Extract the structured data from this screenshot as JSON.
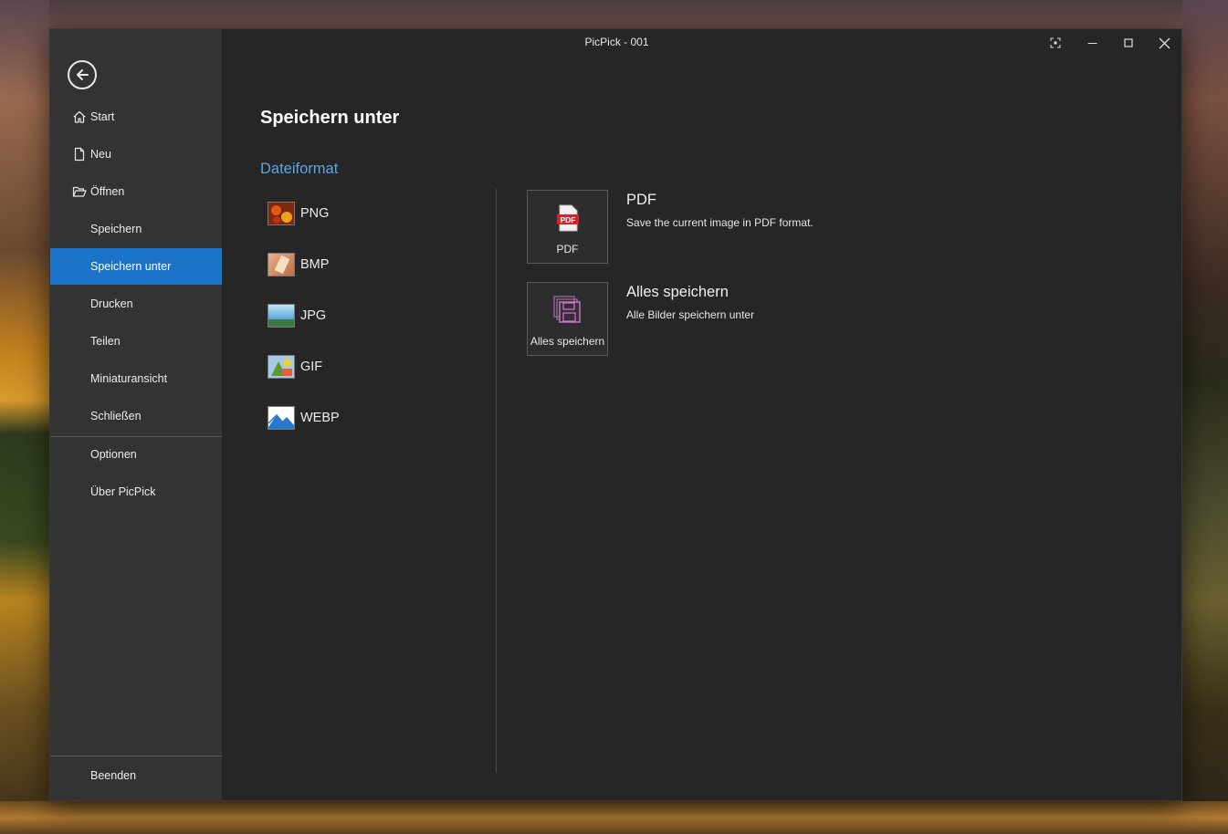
{
  "window": {
    "title": "PicPick - 001"
  },
  "sidebar": {
    "items": [
      {
        "label": "Start",
        "icon": "home-icon"
      },
      {
        "label": "Neu",
        "icon": "new-file-icon"
      },
      {
        "label": "Öffnen",
        "icon": "folder-open-icon"
      },
      {
        "label": "Speichern"
      },
      {
        "label": "Speichern unter",
        "active": true
      },
      {
        "label": "Drucken"
      },
      {
        "label": "Teilen"
      },
      {
        "label": "Miniaturansicht"
      },
      {
        "label": "Schließen"
      },
      {
        "label": "Optionen"
      },
      {
        "label": "Über PicPick"
      },
      {
        "label": "Beenden"
      }
    ]
  },
  "main": {
    "title": "Speichern unter",
    "section": "Dateiformat",
    "formats": [
      "PNG",
      "BMP",
      "JPG",
      "GIF",
      "WEBP"
    ],
    "options": [
      {
        "tile_label": "PDF",
        "title": "PDF",
        "description": "Save the current image in PDF format."
      },
      {
        "tile_label": "Alles speichern",
        "title": "Alles speichern",
        "description": "Alle Bilder speichern unter"
      }
    ]
  },
  "colors": {
    "accent": "#1a73c9",
    "section_title": "#5aa6e6",
    "window_bg": "#262626",
    "sidebar_bg": "#333333"
  }
}
